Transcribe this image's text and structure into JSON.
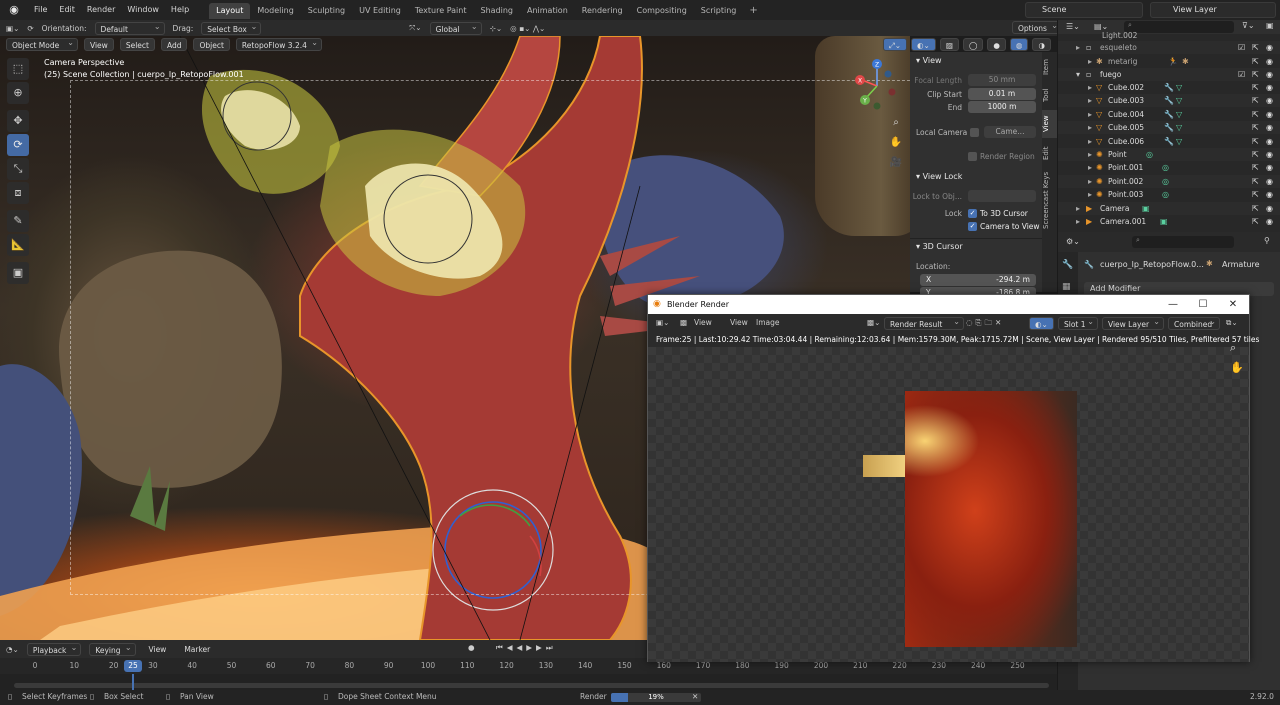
{
  "topbar": {
    "menus": [
      "File",
      "Edit",
      "Render",
      "Window",
      "Help"
    ],
    "workspaces": [
      "Layout",
      "Modeling",
      "Sculpting",
      "UV Editing",
      "Texture Paint",
      "Shading",
      "Animation",
      "Rendering",
      "Compositing",
      "Scripting"
    ],
    "active_workspace": "Layout",
    "scene": "Scene",
    "view_layer": "View Layer"
  },
  "viewport_header": {
    "orientation_label": "Orientation:",
    "orientation_value": "Default",
    "drag_label": "Drag:",
    "drag_value": "Select Box",
    "transform": "Global",
    "options": "Options",
    "mode": "Object Mode",
    "menus": [
      "View",
      "Select",
      "Add",
      "Object"
    ],
    "addon": "RetopoFlow 3.2.4"
  },
  "viewport": {
    "camera_label": "Camera Perspective",
    "collection_label": "(25) Scene Collection | cuerpo_lp_RetopoFlow.001"
  },
  "npanel": {
    "tabs": [
      "Item",
      "Tool",
      "View",
      "Edit",
      "Screencast Keys"
    ],
    "active_tab": "View",
    "view_title": "View",
    "focal_length_label": "Focal Length",
    "focal_length": "50 mm",
    "clip_start_label": "Clip Start",
    "clip_start": "0.01 m",
    "end_label": "End",
    "end": "1000 m",
    "local_camera_label": "Local Camera",
    "local_camera_value": "Came...",
    "render_region": "Render Region",
    "view_lock_title": "View Lock",
    "lock_to_obj_label": "Lock to Obj...",
    "lock_label": "Lock",
    "to_3d_cursor": "To 3D Cursor",
    "camera_to_view": "Camera to View",
    "cursor_title": "3D Cursor",
    "location_label": "Location:",
    "x_label": "X",
    "x_value": "-294.2 m",
    "y_label": "Y",
    "y_value": "-186.8 m"
  },
  "outliner": {
    "items": [
      {
        "name": "Light.002",
        "indent": 1
      },
      {
        "name": "esqueleto",
        "indent": 0
      },
      {
        "name": "metarig",
        "indent": 1
      },
      {
        "name": "fuego",
        "indent": 0
      },
      {
        "name": "Cube.002",
        "indent": 1
      },
      {
        "name": "Cube.003",
        "indent": 1
      },
      {
        "name": "Cube.004",
        "indent": 1
      },
      {
        "name": "Cube.005",
        "indent": 1
      },
      {
        "name": "Cube.006",
        "indent": 1
      },
      {
        "name": "Point",
        "indent": 1
      },
      {
        "name": "Point.001",
        "indent": 1
      },
      {
        "name": "Point.002",
        "indent": 1
      },
      {
        "name": "Point.003",
        "indent": 1
      },
      {
        "name": "Camera",
        "indent": 0
      },
      {
        "name": "Camera.001",
        "indent": 0
      }
    ]
  },
  "properties": {
    "object_name": "cuerpo_lp_RetopoFlow.0...",
    "armature_label": "Armature",
    "add_modifier": "Add Modifier"
  },
  "render_window": {
    "title": "Blender Render",
    "menus": [
      "View",
      "View",
      "Image"
    ],
    "image_name": "Render Result",
    "slot": "Slot 1",
    "view_layer": "View Layer",
    "pass": "Combined",
    "info": "Frame:25 | Last:10:29.42 Time:03:04.44 | Remaining:12:03.64 | Mem:1579.30M, Peak:1715.72M | Scene, View Layer | Rendered 95/510 Tiles, Prefiltered 57 tiles"
  },
  "timeline": {
    "menus": [
      "Playback",
      "Keying",
      "View",
      "Marker"
    ],
    "current_frame": "25",
    "ticks": [
      "0",
      "10",
      "20",
      "30",
      "40",
      "50",
      "60",
      "70",
      "80",
      "90",
      "100",
      "110",
      "120",
      "130",
      "140",
      "150",
      "160",
      "170",
      "180",
      "190",
      "200",
      "210",
      "220",
      "230",
      "240",
      "250"
    ]
  },
  "statusbar": {
    "select_keyframes": "Select Keyframes",
    "box_select": "Box Select",
    "pan_view": "Pan View",
    "context_menu": "Dope Sheet Context Menu",
    "render_label": "Render",
    "progress_text": "19%",
    "progress": 0.19,
    "version": "2.92.0"
  },
  "colors": {
    "accent": "#4772b3",
    "selection_outline": "#e8952a",
    "fire": "#d0401a"
  }
}
